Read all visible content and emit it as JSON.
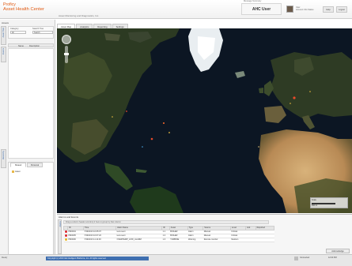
{
  "header": {
    "brand_line1": "Proficy",
    "brand_line2": "Asset Health Center",
    "subtitle": "Asset Monitoring and Diagnostics, Inc.",
    "messages_label": "Message Summary",
    "user_title": "AHC User",
    "user_line1": "User",
    "user_line2": "Account Info Status",
    "btn_help": "Help",
    "btn_logout": "Logout"
  },
  "left_panel": {
    "title": "Assets",
    "vtabs": [
      "Asset Tree",
      "Events",
      "Hierarchy"
    ],
    "filter": {
      "category_label": "Category",
      "category_value": "All",
      "search_label": "Search Tree",
      "search_placeholder": "Search"
    },
    "columns": [
      "Name",
      "Description"
    ],
    "lower_tabs": [
      "Shared",
      "Personal"
    ],
    "tree_item": "Asset"
  },
  "main_tabs": [
    "Asset Map",
    "Analytics",
    "Reporting",
    "Settings"
  ],
  "map": {
    "scale_label": "Scale",
    "scale_value": "500 mi"
  },
  "alarms": {
    "title": "Alarms and Events",
    "side_label": "Alarms",
    "info_text": "Drag a column header and drop it here to group by that column",
    "columns": [
      "",
      "ID",
      "Time",
      "Alarm Name",
      "ID",
      "Asset",
      "Type",
      "Source",
      "Level",
      "Ack",
      "Reported"
    ],
    "rows": [
      {
        "color": "#d9262c",
        "id": "PM0004",
        "time": "7/19/2013 10:05:07",
        "name": "test event",
        "num": "1.1",
        "asset": "BOILER",
        "type": "Alarm",
        "source": "Manual",
        "level": "Critical",
        "ack": "",
        "reported": ""
      },
      {
        "color": "#d9262c",
        "id": "PM0005",
        "time": "7/19/2013 10:07:22",
        "name": "test event",
        "num": "1.2",
        "asset": "BOILER",
        "type": "Alarm",
        "source": "Manual",
        "level": "Critical",
        "ack": "",
        "reported": ""
      },
      {
        "color": "#e6b422",
        "id": "PM0006",
        "time": "7/19/2013 11:14:03",
        "name": "OVERTEMP_LOW_ALARM",
        "num": "1.3",
        "asset": "TURBINE",
        "type": "Warning",
        "source": "Remote monitor",
        "level": "Medium",
        "ack": "",
        "reported": ""
      }
    ],
    "ack_button": "Acknowledge"
  },
  "statusbar": {
    "left": "Ready",
    "blue": "Copyright (c) 2013 GE Intelligent Platforms, Inc. All rights reserved.",
    "right1": "Connected",
    "right2": "12:00 PM"
  },
  "colors": {
    "brand": "#e15a12",
    "accent_blue": "#3f6fb0",
    "map_ocean": "#0c1623"
  }
}
